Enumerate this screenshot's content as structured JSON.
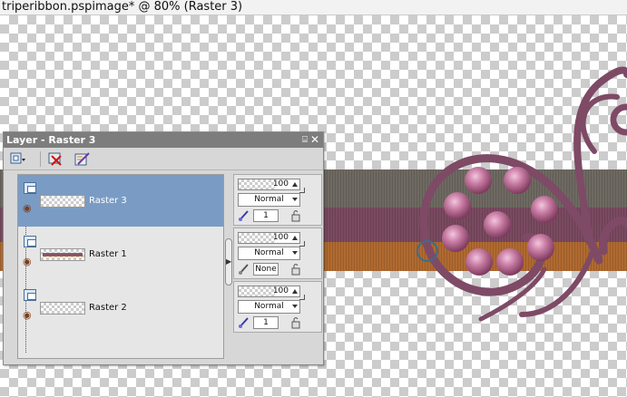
{
  "window": {
    "title": "triperibbon.pspimage* @  80% (Raster 3)"
  },
  "palette": {
    "title": "Layer - Raster 3",
    "pin_glyph": "⌸",
    "close_glyph": "✕",
    "toolbar": [
      {
        "icon": "new-layer-icon"
      },
      {
        "icon": "delete-layer-icon"
      },
      {
        "icon": "layer-properties-icon"
      }
    ],
    "layers": [
      {
        "name": "Raster 3",
        "selected": true,
        "opacity": "100",
        "blend": "Normal",
        "edge": "1"
      },
      {
        "name": "Raster 1",
        "selected": false,
        "opacity": "100",
        "blend": "Normal",
        "edge": "None"
      },
      {
        "name": "Raster 2",
        "selected": false,
        "opacity": "100",
        "blend": "Normal",
        "edge": "1"
      }
    ],
    "splitter_glyph": "▶"
  },
  "colors": {
    "ribbon_gray": "#6e6a62",
    "ribbon_plum": "#7a4a60",
    "ribbon_orange": "#b06a30",
    "swirl_plum": "#7e4a66",
    "bead_pink": "#c77ba2",
    "selection_blue": "#7a9cc4"
  }
}
